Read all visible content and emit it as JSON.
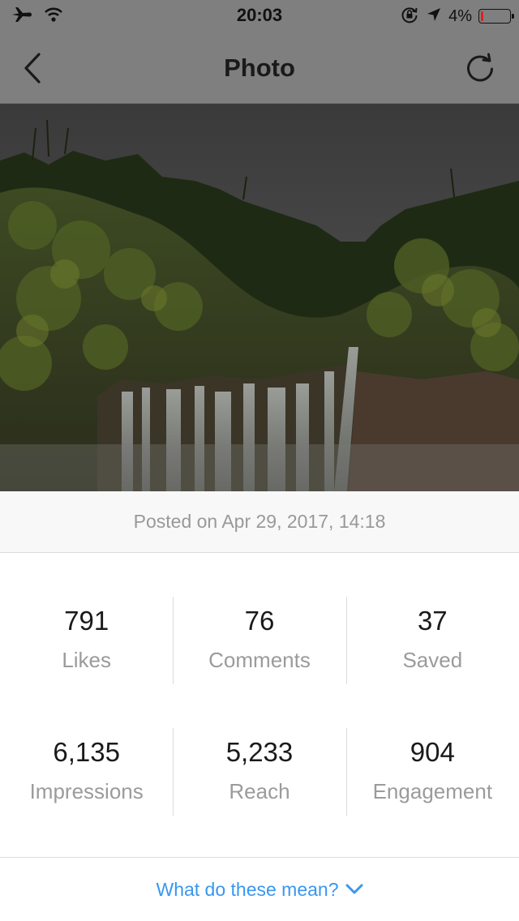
{
  "status_bar": {
    "time": "20:03",
    "battery_text": "4%",
    "battery_level": 0.04,
    "icons": [
      "airplane-icon",
      "wifi-icon",
      "rotation-lock-icon",
      "location-arrow-icon",
      "battery-icon"
    ]
  },
  "nav": {
    "title": "Photo",
    "back_icon": "chevron-left-icon",
    "refresh_icon": "refresh-icon"
  },
  "post": {
    "posted_text": "Posted on Apr 29, 2017, 14:18"
  },
  "stats": {
    "row1": [
      {
        "value": "791",
        "label": "Likes"
      },
      {
        "value": "76",
        "label": "Comments"
      },
      {
        "value": "37",
        "label": "Saved"
      }
    ],
    "row2": [
      {
        "value": "6,135",
        "label": "Impressions"
      },
      {
        "value": "5,233",
        "label": "Reach"
      },
      {
        "value": "904",
        "label": "Engagement"
      }
    ]
  },
  "help": {
    "text": "What do these mean?",
    "icon": "chevron-down-icon"
  },
  "colors": {
    "link": "#3897f0",
    "battery_low": "#e02020",
    "muted_text": "#999999"
  }
}
